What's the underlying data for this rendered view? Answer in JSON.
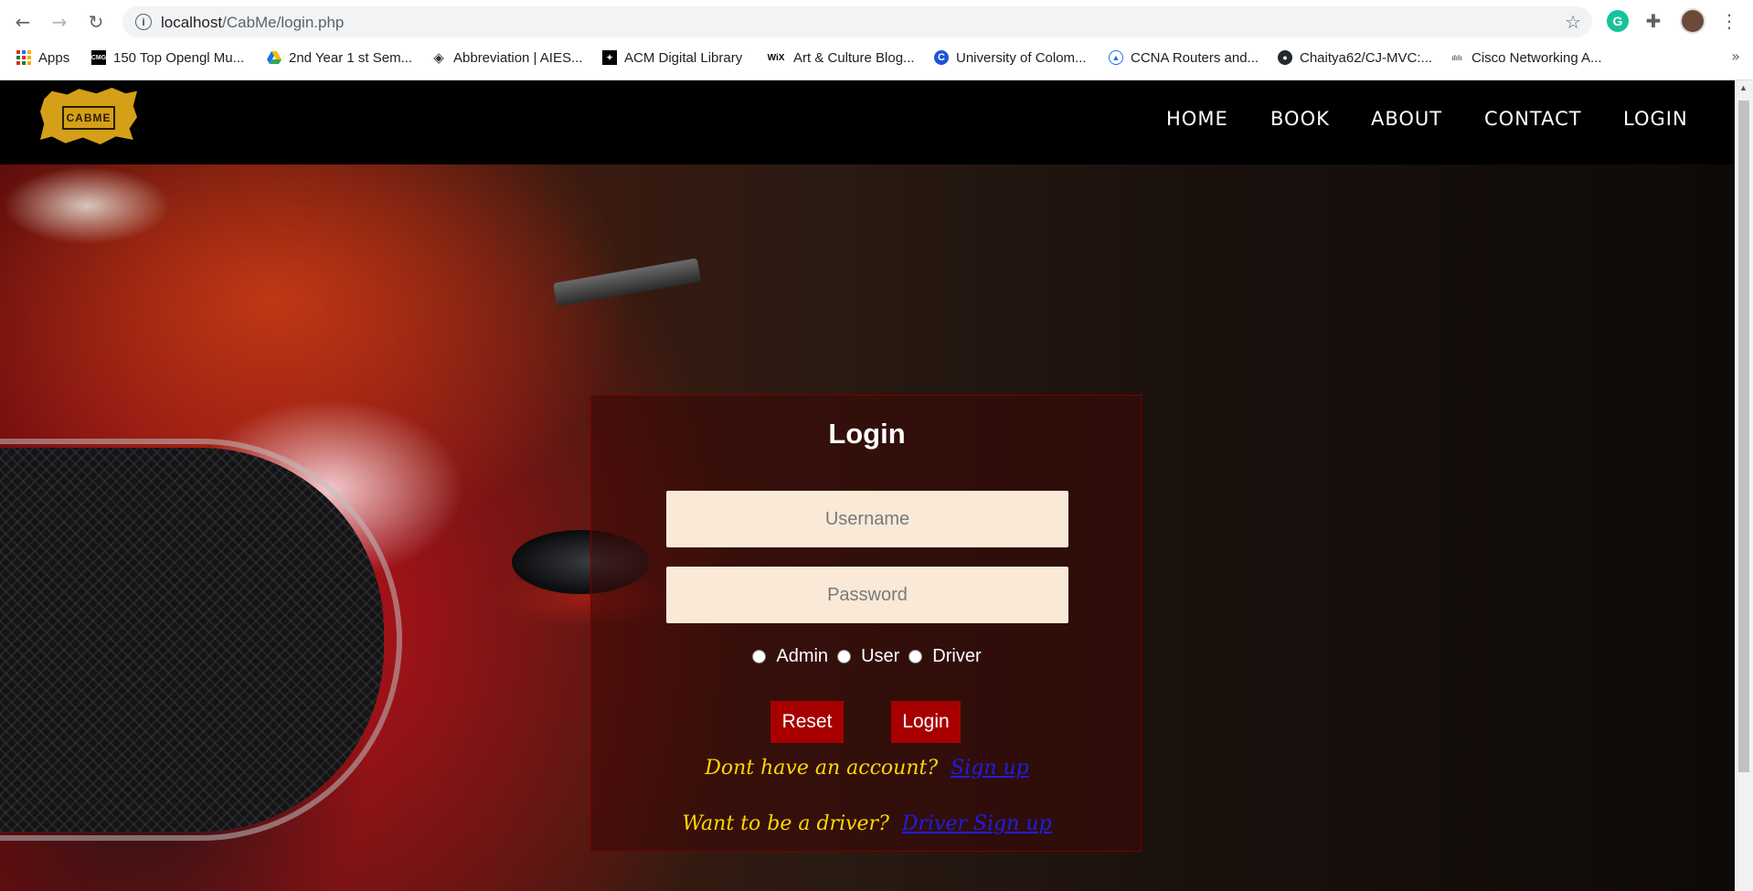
{
  "browser": {
    "url_host": "localhost",
    "url_path": "/CabMe/login.php",
    "bookmarks": [
      {
        "label": "Apps",
        "icon": "apps-grid-icon"
      },
      {
        "label": "150 Top Opengl Mu...",
        "icon": "cmg-favicon"
      },
      {
        "label": "2nd Year 1 st Sem...",
        "icon": "google-drive-icon"
      },
      {
        "label": "Abbreviation | AIES...",
        "icon": "diamond-favicon"
      },
      {
        "label": "ACM Digital Library",
        "icon": "acm-favicon"
      },
      {
        "label": "Art & Culture Blog...",
        "icon": "wix-favicon"
      },
      {
        "label": "University of Colom...",
        "icon": "university-favicon"
      },
      {
        "label": "CCNA Routers and...",
        "icon": "ccna-favicon"
      },
      {
        "label": "Chaitya62/CJ-MVC:...",
        "icon": "github-icon"
      },
      {
        "label": "Cisco Networking A...",
        "icon": "cisco-favicon"
      }
    ],
    "more_bookmarks": "»"
  },
  "site": {
    "logo_text": "CABME",
    "nav": [
      "HOME",
      "BOOK",
      "ABOUT",
      "CONTACT",
      "LOGIN"
    ]
  },
  "login": {
    "title": "Login",
    "username_placeholder": "Username",
    "password_placeholder": "Password",
    "roles": [
      "Admin",
      "User",
      "Driver"
    ],
    "reset_label": "Reset",
    "login_label": "Login",
    "signup_prompt": "Dont have an account?",
    "signup_link": "Sign up",
    "driver_prompt": "Want to be a driver?",
    "driver_link": "Driver Sign up"
  },
  "colors": {
    "nav_bg": "#000000",
    "logo_yellow": "#d4a017",
    "button_red": "#a80000",
    "prompt_yellow": "#ffd700",
    "link_blue": "#1e1ee6",
    "input_bg": "#f9e9d6"
  }
}
